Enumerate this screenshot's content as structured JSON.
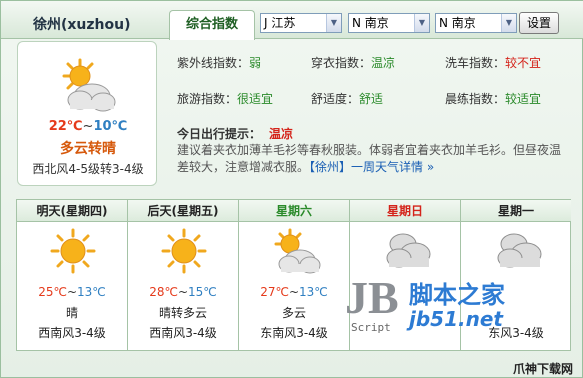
{
  "header": {
    "city": "徐州(xuzhou)",
    "tab_label": "综合指数",
    "province_select": "J 江苏",
    "city_select_1": "N 南京",
    "city_select_2": "N 南京",
    "settings_label": "设置"
  },
  "today": {
    "icon": "cloudy-sunny-icon",
    "temp_high": "22℃",
    "temp_sep": "~",
    "temp_low": "10℃",
    "condition": "多云转晴",
    "wind": "西北风4-5级转3-4级"
  },
  "indices": [
    {
      "label": "紫外线指数：",
      "value": "弱"
    },
    {
      "label": "穿衣指数：",
      "value": "温凉"
    },
    {
      "label": "洗车指数：",
      "value": "较不宜"
    },
    {
      "label": "旅游指数：",
      "value": "很适宜"
    },
    {
      "label": "舒适度：",
      "value": "舒适"
    },
    {
      "label": "晨练指数：",
      "value": "较适宜"
    }
  ],
  "tip": {
    "label": "今日出行提示：",
    "value": "温凉",
    "text": "建议着夹衣加薄羊毛衫等春秋服装。体弱者宜着夹衣加羊毛衫。但昼夜温差较大，注意增减衣服。",
    "link": "【徐州】一周天气详情 »"
  },
  "forecast": [
    {
      "day": "明天(星期四)",
      "color": "#222222",
      "icon": "sunny-icon",
      "hi": "25℃",
      "lo": "13℃",
      "cond": "晴",
      "wind": "西南风3-4级"
    },
    {
      "day": "后天(星期五)",
      "color": "#222222",
      "icon": "sunny-icon",
      "hi": "28℃",
      "lo": "15℃",
      "cond": "晴转多云",
      "wind": "西南风3-4级"
    },
    {
      "day": "星期六",
      "color": "#2a8a2a",
      "icon": "cloudy-sunny-icon",
      "hi": "27℃",
      "lo": "13℃",
      "cond": "多云",
      "wind": "东南风3-4级"
    },
    {
      "day": "星期日",
      "color": "#d4231a",
      "icon": "overcast-icon",
      "hi": "",
      "lo": "",
      "cond": "",
      "wind": ""
    },
    {
      "day": "星期一",
      "color": "#222222",
      "icon": "overcast-icon",
      "hi": "",
      "lo": "",
      "cond": "",
      "wind": "东风3-4级"
    }
  ],
  "watermark": {
    "logo": "JB",
    "script": "Script",
    "cn": "脚本之家",
    "url": "jb51.net"
  },
  "corner_text": "爪神下载网"
}
